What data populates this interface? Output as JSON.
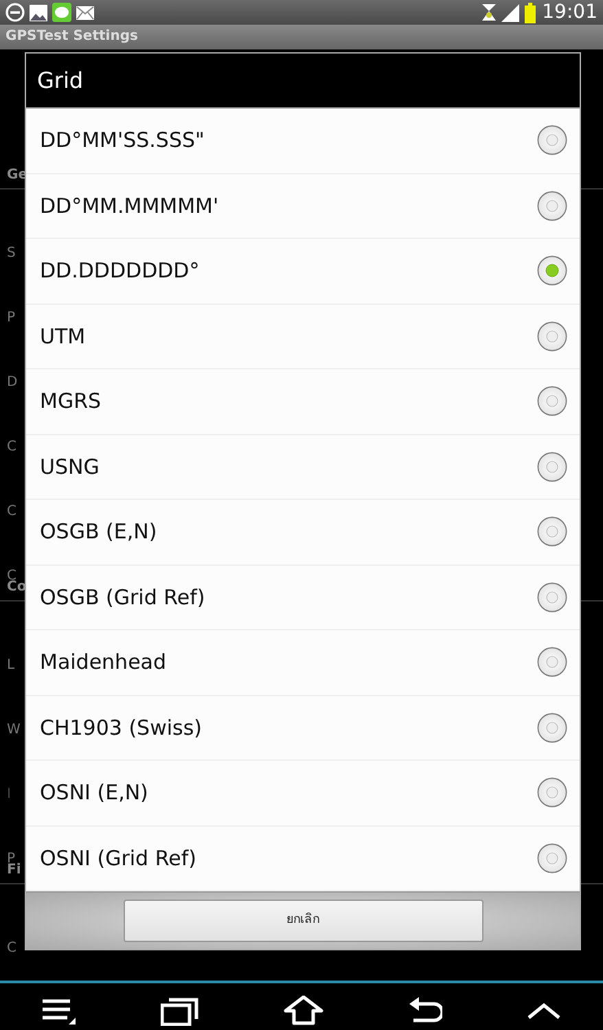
{
  "status_bar": {
    "time": "19:01"
  },
  "app_bar": {
    "title": "GPSTest Settings"
  },
  "background_list": [
    {
      "kind": "header",
      "text": "Ge"
    },
    {
      "kind": "item",
      "summary": "S"
    },
    {
      "kind": "item",
      "summary": "P"
    },
    {
      "kind": "item",
      "summary": "D"
    },
    {
      "kind": "item",
      "summary": "C"
    },
    {
      "kind": "item",
      "summary": "C"
    },
    {
      "kind": "item",
      "summary": "C"
    },
    {
      "kind": "header",
      "text": "Co"
    },
    {
      "kind": "item",
      "summary": "L"
    },
    {
      "kind": "item",
      "summary": "W"
    },
    {
      "kind": "item",
      "summary": "I",
      "disabled": true
    },
    {
      "kind": "item",
      "summary": "P"
    },
    {
      "kind": "header",
      "text": "Fi"
    },
    {
      "kind": "item",
      "summary": "C"
    }
  ],
  "dialog": {
    "title": "Grid",
    "options": [
      {
        "label": "DD°MM'SS.SSS\"",
        "selected": false
      },
      {
        "label": "DD°MM.MMMMM'",
        "selected": false
      },
      {
        "label": "DD.DDDDDDD°",
        "selected": true
      },
      {
        "label": "UTM",
        "selected": false
      },
      {
        "label": "MGRS",
        "selected": false
      },
      {
        "label": "USNG",
        "selected": false
      },
      {
        "label": "OSGB (E,N)",
        "selected": false
      },
      {
        "label": "OSGB (Grid Ref)",
        "selected": false
      },
      {
        "label": "Maidenhead",
        "selected": false
      },
      {
        "label": "CH1903 (Swiss)",
        "selected": false
      },
      {
        "label": "OSNI (E,N)",
        "selected": false
      },
      {
        "label": "OSNI (Grid Ref)",
        "selected": false
      }
    ],
    "cancel_button": "ยกเลิก"
  }
}
